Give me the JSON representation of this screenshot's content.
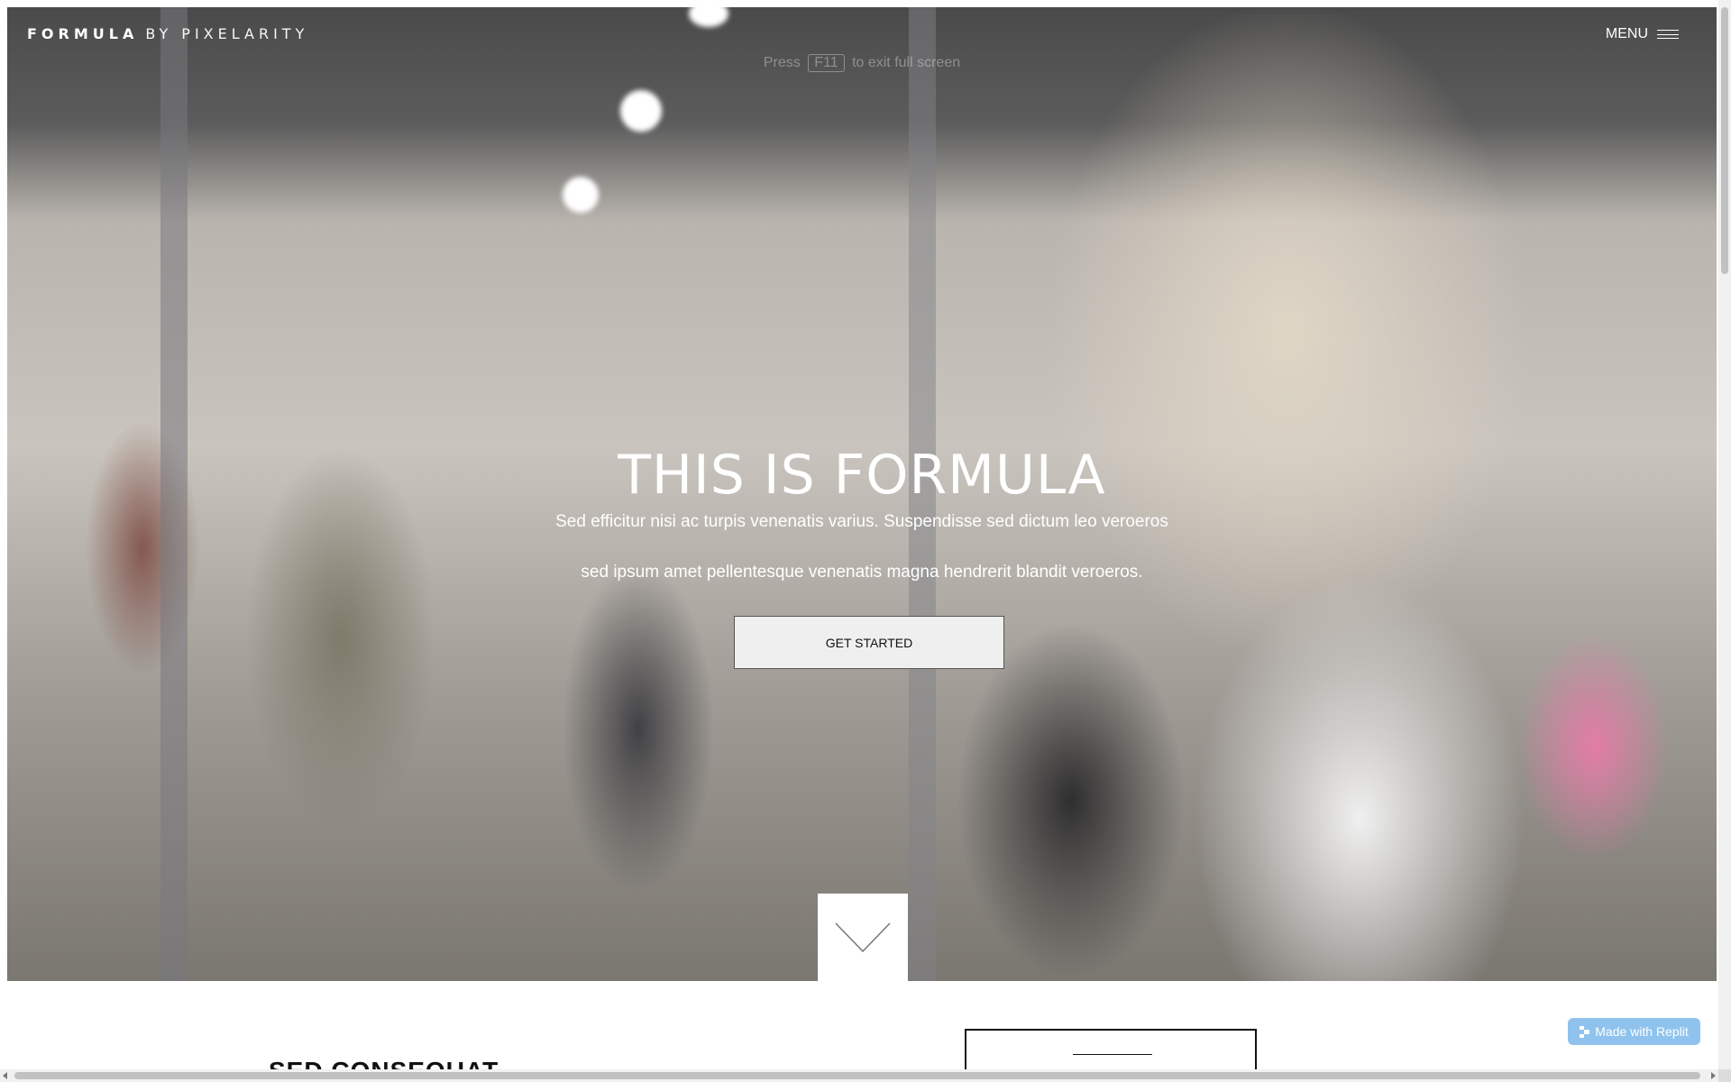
{
  "header": {
    "brand_primary": "FORMULA",
    "brand_secondary": "BY PIXELARITY",
    "menu_label": "MENU"
  },
  "fullscreen_hint": {
    "prefix": "Press",
    "key": "F11",
    "suffix": "to exit full screen"
  },
  "hero": {
    "title": "THIS IS FORMULA",
    "subtitle_line1": "Sed efficitur nisi ac turpis venenatis varius. Suspendisse sed dictum leo veroeros",
    "subtitle_line2": "sed ipsum amet pellentesque venenatis magna hendrerit blandit veroeros.",
    "cta_label": "GET STARTED"
  },
  "section": {
    "heading": "SED CONSEQUAT"
  },
  "badge": {
    "label": "Made with Replit"
  },
  "icons": {
    "menu": "hamburger-icon",
    "scroll_down": "chevron-down-icon",
    "replit": "replit-logo-icon"
  },
  "colors": {
    "accent_badge": "#8fc3ee",
    "cta_background": "#efefef",
    "text_on_hero": "#ffffff"
  }
}
